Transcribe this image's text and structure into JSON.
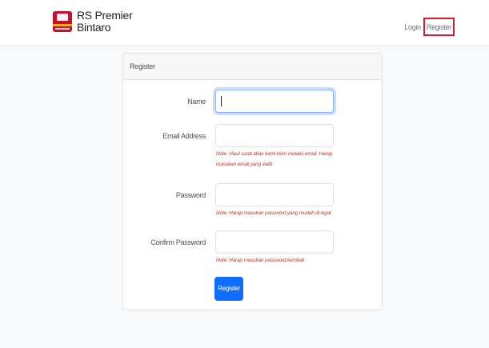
{
  "brand": {
    "line1": "RS Premier",
    "line2": "Bintaro"
  },
  "nav": {
    "login": "Login",
    "register": "Register"
  },
  "card": {
    "title": "Register"
  },
  "form": {
    "name_label": "Name",
    "email_label": "Email Address",
    "email_note": "Note: Hasil surat akan kami kirim melalui email, Harap masukan email yang valid",
    "password_label": "Password",
    "password_note": "Note: Harap masukan password yang mudah di ingat",
    "confirm_label": "Confirm Password",
    "confirm_note": "Note: Harap masukan password kembali",
    "submit": "Register"
  },
  "colors": {
    "accent": "#0d6efd",
    "note": "#c0392b",
    "highlight_border": "#d81b2c"
  }
}
